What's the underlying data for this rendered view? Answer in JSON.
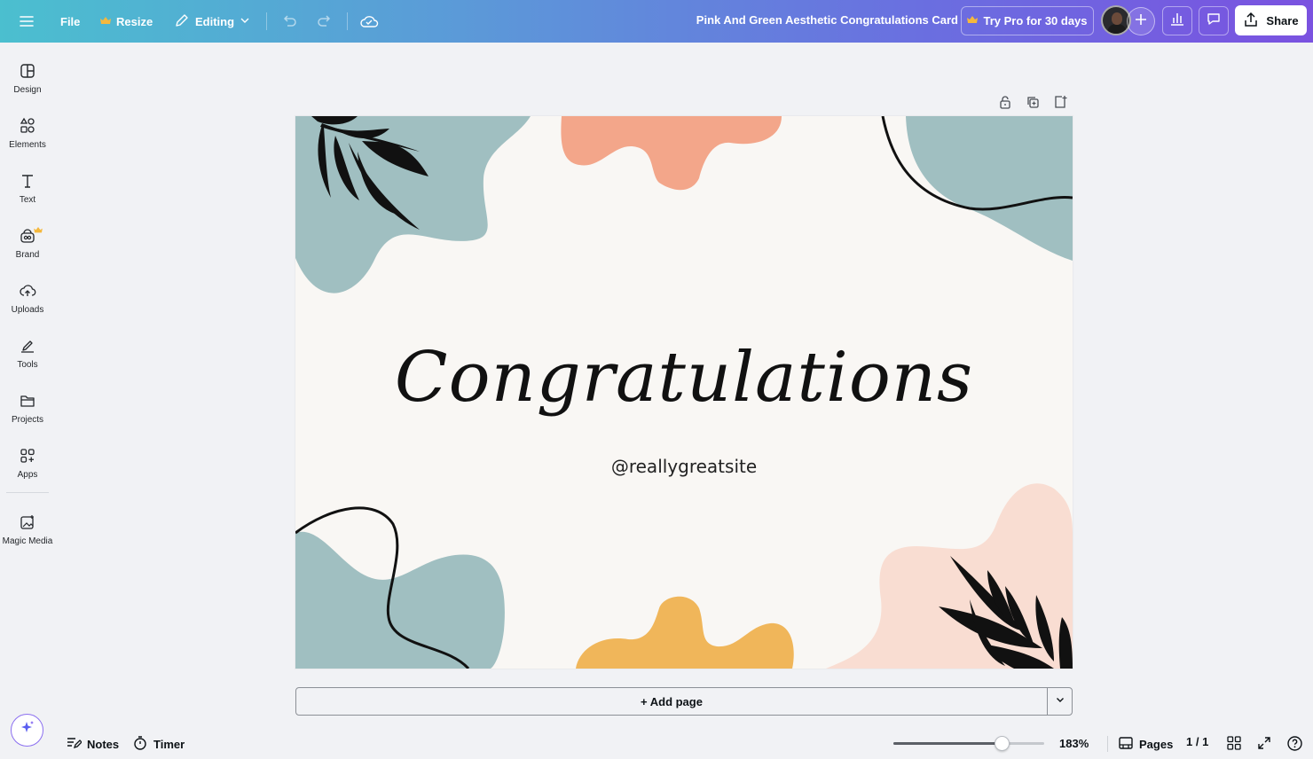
{
  "topbar": {
    "menu_icon": "hamburger-icon",
    "file_label": "File",
    "resize_label": "Resize",
    "editing_label": "Editing",
    "doc_title": "Pink And Green Aesthetic Congratulations Card",
    "try_pro_label": "Try Pro for 30 days",
    "share_label": "Share",
    "crown_color": "#f5b83d"
  },
  "sidebar": {
    "items": [
      {
        "label": "Design",
        "icon": "design-icon"
      },
      {
        "label": "Elements",
        "icon": "elements-icon"
      },
      {
        "label": "Text",
        "icon": "text-icon"
      },
      {
        "label": "Brand",
        "icon": "brand-icon"
      },
      {
        "label": "Uploads",
        "icon": "uploads-icon"
      },
      {
        "label": "Tools",
        "icon": "tools-icon"
      },
      {
        "label": "Projects",
        "icon": "projects-icon"
      },
      {
        "label": "Apps",
        "icon": "apps-icon"
      },
      {
        "label": "Magic Media",
        "icon": "magic-media-icon"
      }
    ]
  },
  "design": {
    "headline": "Congratulations",
    "handle": "@reallygreatsite",
    "colors": {
      "background": "#f9f7f4",
      "teal": "#a0bfc1",
      "salmon": "#f3a68a",
      "pink": "#f9ddd2",
      "mustard": "#f0b65a",
      "ink": "#111111"
    }
  },
  "add_page": {
    "label": "+ Add page"
  },
  "bottombar": {
    "notes_label": "Notes",
    "timer_label": "Timer",
    "zoom_label": "183%",
    "zoom_fraction": 0.72,
    "pages_label": "Pages",
    "page_count": "1 / 1"
  }
}
